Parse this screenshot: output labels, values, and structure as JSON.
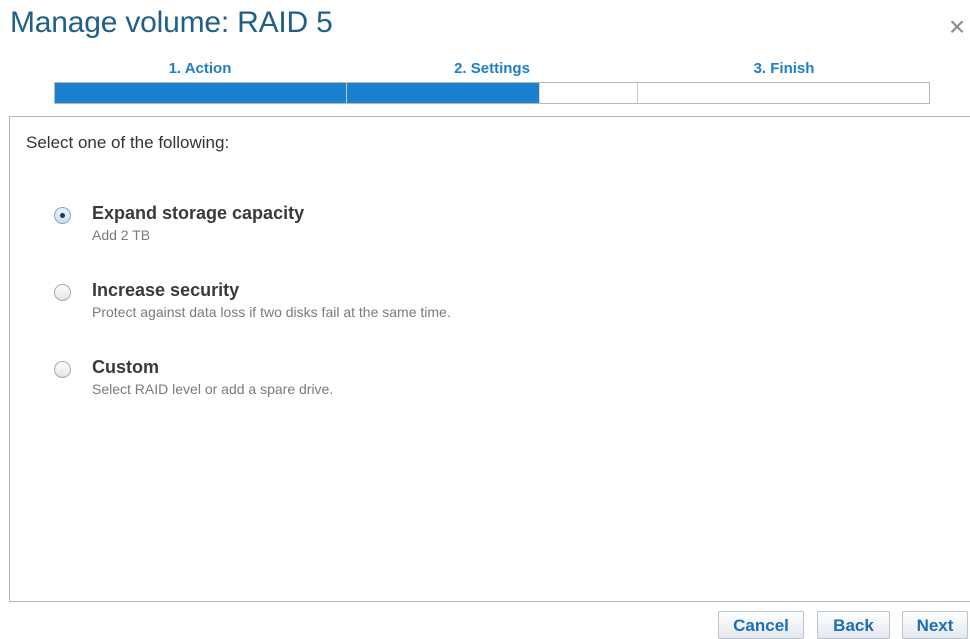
{
  "dialog": {
    "title": "Manage volume: RAID 5",
    "close_glyph": "×"
  },
  "steps": [
    {
      "label": "1. Action",
      "progress": 1.0
    },
    {
      "label": "2. Settings",
      "progress": 0.66
    },
    {
      "label": "3. Finish",
      "progress": 0.0
    }
  ],
  "panel": {
    "prompt": "Select one of the following:",
    "options": [
      {
        "title": "Expand storage capacity",
        "subtitle": "Add 2 TB",
        "selected": true
      },
      {
        "title": "Increase security",
        "subtitle": "Protect against data loss if two disks fail at the same time.",
        "selected": false
      },
      {
        "title": "Custom",
        "subtitle": "Select RAID level or add a spare drive.",
        "selected": false
      }
    ]
  },
  "footer": {
    "cancel_label": "Cancel",
    "back_label": "Back",
    "next_label": "Next"
  },
  "colors": {
    "accent": "#1a80d0",
    "title": "#1f5f8b"
  }
}
